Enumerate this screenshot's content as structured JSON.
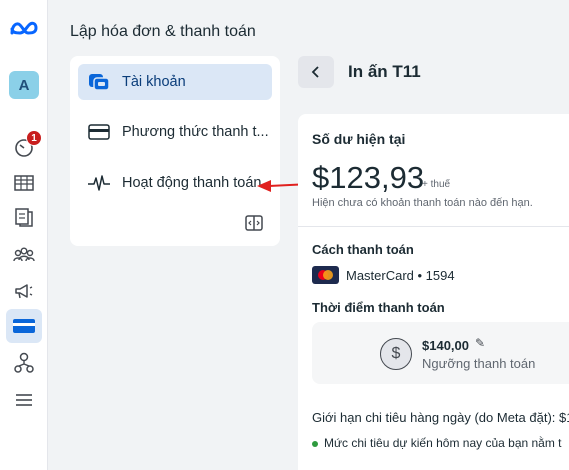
{
  "rail": {
    "avatar_letter": "A",
    "notification_count": "1"
  },
  "section_title": "Lập hóa đơn & thanh toán",
  "nav": {
    "items": [
      {
        "label": "Tài khoản",
        "icon": "accounts-icon",
        "active": true
      },
      {
        "label": "Phương thức thanh t...",
        "icon": "credit-card-icon",
        "active": false
      },
      {
        "label": "Hoạt động thanh toán",
        "icon": "activity-pulse-icon",
        "active": false
      }
    ]
  },
  "header": {
    "title": "In ấn T11"
  },
  "balance": {
    "label": "Số dư hiện tại",
    "amount": "$123,93",
    "tax": "+ thuế",
    "note": "Hiện chưa có khoản thanh toán nào đến hạn."
  },
  "payment": {
    "method_label": "Cách thanh toán",
    "card_text": "MasterCard • 1594",
    "timing_label": "Thời điểm thanh toán",
    "threshold_amount": "$140,00",
    "threshold_label": "Ngưỡng thanh toán"
  },
  "limits": {
    "daily_limit_text": "Giới hạn chi tiêu hàng ngày (do Meta đặt): $1.",
    "estimate_text": "Mức chi tiêu dự kiến hôm nay của bạn nằm t"
  },
  "colors": {
    "accent": "#0a3d7a",
    "active_bg": "#dbe7f6",
    "annotation_arrow": "#e0201e"
  }
}
